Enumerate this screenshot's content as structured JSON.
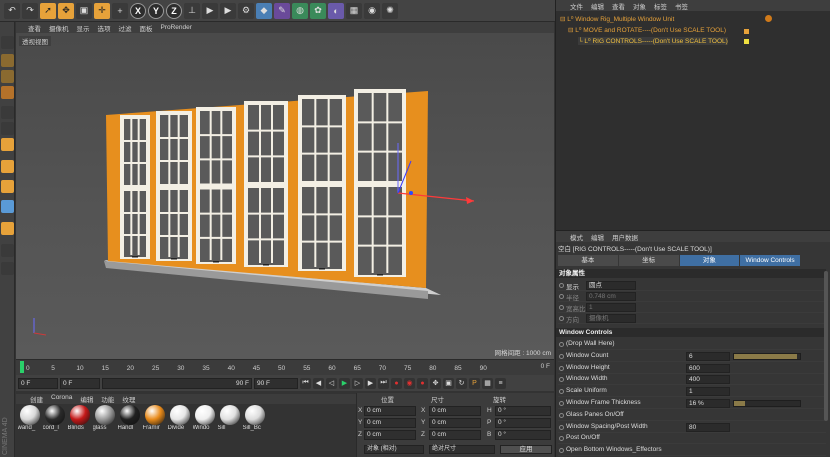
{
  "toolbar": {
    "axis_x": "X",
    "axis_y": "Y",
    "axis_z": "Z"
  },
  "viewport": {
    "menu": [
      "查看",
      "摄像机",
      "显示",
      "选项",
      "过滤",
      "面板",
      "ProRender"
    ],
    "label": "透视视图",
    "grid_info": "网格间距 : 1000 cm"
  },
  "timeline": {
    "ticks": [
      "0",
      "5",
      "10",
      "15",
      "20",
      "25",
      "30",
      "35",
      "40",
      "45",
      "50",
      "55",
      "60",
      "65",
      "70",
      "75",
      "80",
      "85",
      "90"
    ],
    "frame_display": "0 F"
  },
  "transport": {
    "start": "0 F",
    "current": "0 F",
    "range_end": "90 F",
    "end": "90 F"
  },
  "materials": {
    "menu": [
      "创建",
      "Corona",
      "编辑",
      "功能",
      "纹理"
    ],
    "items": [
      {
        "label": "wand_",
        "color": "#d8d8d8"
      },
      {
        "label": "cord_l",
        "color": "#2a2a2a"
      },
      {
        "label": "Blinds",
        "color": "#c41818"
      },
      {
        "label": "glass",
        "color": "#9a9a9a"
      },
      {
        "label": "Handl",
        "color": "#202020"
      },
      {
        "label": "Framir",
        "color": "#e88a1a"
      },
      {
        "label": "Divide",
        "color": "#e6e6e6"
      },
      {
        "label": "Windo",
        "color": "#eeeeee"
      },
      {
        "label": "Sill",
        "color": "#e0e0e0"
      },
      {
        "label": "Sill_Bc",
        "color": "#dcdcdc"
      }
    ]
  },
  "coords": {
    "headers": [
      "位置",
      "尺寸",
      "旋转"
    ],
    "rows": [
      {
        "axis": "X",
        "pos": "0 cm",
        "size": "0 cm",
        "rot_label": "H",
        "rot": "0 °"
      },
      {
        "axis": "Y",
        "pos": "0 cm",
        "size": "0 cm",
        "rot_label": "P",
        "rot": "0 °"
      },
      {
        "axis": "Z",
        "pos": "0 cm",
        "size": "0 cm",
        "rot_label": "B",
        "rot": "0 °"
      }
    ],
    "mode": "对象 (相对)",
    "size_mode": "绝对尺寸",
    "apply": "应用"
  },
  "objects": {
    "menu": [
      "文件",
      "编辑",
      "查看",
      "对象",
      "标签",
      "书签"
    ],
    "tree": [
      {
        "name": "Window Rig_Multiple Window Unit",
        "color": "#e7a23a"
      },
      {
        "name": "MOVE and ROTATE----(Don't Use SCALE TOOL)",
        "color": "#e7a23a"
      },
      {
        "name": "RIG CONTROLS-----(Don't Use SCALE TOOL)",
        "color": "#f0c040"
      }
    ]
  },
  "attributes": {
    "menu": [
      "模式",
      "编辑",
      "用户数据"
    ],
    "path": "空白 [RIG CONTROLS-----(Don't Use SCALE TOOL)]",
    "tabs": [
      "基本",
      "坐标",
      "对象",
      "Window Controls"
    ],
    "section_object": "对象属性",
    "object_props": [
      {
        "name": "显示",
        "value": "圆点",
        "dim": false
      },
      {
        "name": "半径",
        "value": "0.748 cm",
        "dim": true
      },
      {
        "name": "宽高比",
        "value": "1",
        "dim": true
      },
      {
        "name": "方向",
        "value": "摄像机",
        "dim": true
      }
    ],
    "section_window": "Window Controls",
    "window_props": [
      {
        "name": "(Drop Wall Here)",
        "value": "",
        "bar": null
      },
      {
        "name": "Window Count",
        "value": "6",
        "bar": 0.95
      },
      {
        "name": "Window Height",
        "value": "600",
        "bar": null
      },
      {
        "name": "Window Width",
        "value": "400",
        "bar": null
      },
      {
        "name": "Scale Uniform",
        "value": "1",
        "bar": null
      },
      {
        "name": "Window Frame Thickness",
        "value": "16 %",
        "bar": 0.16
      },
      {
        "name": "Glass Panes On/Off",
        "value": "",
        "bar": null
      },
      {
        "name": "Window Spacing/Post Width",
        "value": "80",
        "bar": null
      },
      {
        "name": "Post On/Off",
        "value": "",
        "bar": null
      },
      {
        "name": "Open Bottom Windows_Effectors",
        "value": "",
        "bar": null
      }
    ]
  }
}
